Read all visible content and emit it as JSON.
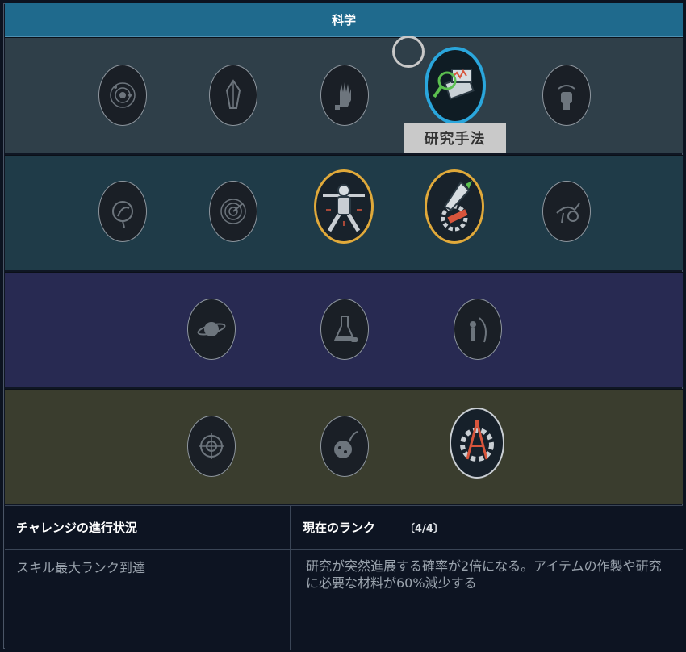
{
  "header": {
    "title": "科学"
  },
  "tooltip": {
    "text": "研究手法"
  },
  "tiers": [
    {
      "skills": [
        "solar-system-icon",
        "crystal-icon",
        "glove-icon",
        "research-methods-icon",
        "helmet-device-icon"
      ]
    },
    {
      "skills": [
        "planet-scan-icon",
        "radar-icon",
        "astronaut-icon",
        "rocket-gear-icon",
        "creature-icon"
      ]
    },
    {
      "skills": [
        "ringed-planet-icon",
        "lab-flask-icon",
        "alien-figure-icon"
      ]
    },
    {
      "skills": [
        "crosshair-icon",
        "asteroid-icon",
        "compass-gear-icon"
      ]
    }
  ],
  "bottom": {
    "challenge_title": "チャレンジの進行状況",
    "challenge_text": "スキル最大ランク到達",
    "rank_title": "現在のランク",
    "rank_count": "〔4/4〕",
    "rank_desc": "研究が突然進展する確率が2倍になる。アイテムの作製や研究に必要な材料が60%減少する"
  },
  "colors": {
    "header": "#1f6a8d",
    "tier1": "#2f3f49",
    "tier2": "#1f3b48",
    "tier3": "#282a52",
    "tier4": "#3a3d2e",
    "active_border": "#e0a93a",
    "selected_border": "#2aa6dc"
  }
}
